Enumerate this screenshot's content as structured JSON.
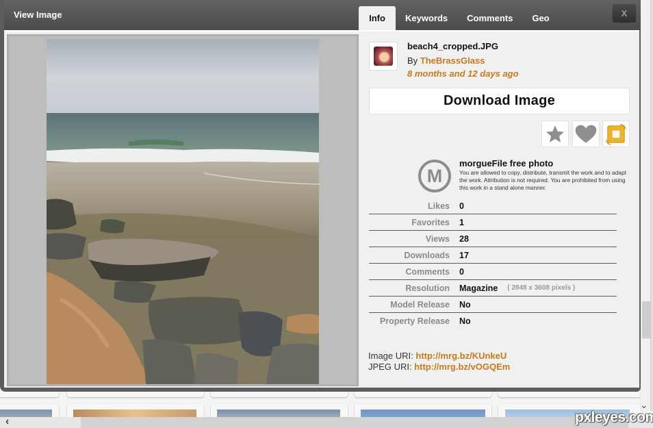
{
  "modal": {
    "title": "View Image",
    "close_label": "X",
    "tabs": [
      {
        "label": "Info",
        "active": true
      },
      {
        "label": "Keywords",
        "active": false
      },
      {
        "label": "Comments",
        "active": false
      },
      {
        "label": "Geo",
        "active": false
      }
    ]
  },
  "photo": {
    "description": "Beach scene with grey overcast sky, green-grey sea with breaking waves, wet sand and rocks in the foreground"
  },
  "info": {
    "filename": "beach4_cropped.JPG",
    "by_prefix": "By",
    "author": "TheBrassGlass",
    "posted": "8 months and 12 days ago",
    "download_label": "Download Image",
    "actions": [
      {
        "name": "favorite",
        "icon": "star-icon"
      },
      {
        "name": "like",
        "icon": "heart-icon"
      },
      {
        "name": "lightbox",
        "icon": "frame-icon"
      }
    ],
    "license": {
      "logo_letter": "M",
      "title": "morgueFile free photo",
      "text": "You are allowed to copy, distribute, transmit the work and to adapt the work. Attribution is not required. You are prohibited from using this work in a stand alone manner."
    },
    "meta": [
      {
        "label": "Likes",
        "value": "0"
      },
      {
        "label": "Favorites",
        "value": "1"
      },
      {
        "label": "Views",
        "value": "28"
      },
      {
        "label": "Downloads",
        "value": "17"
      },
      {
        "label": "Comments",
        "value": "0"
      },
      {
        "label": "Resolution",
        "value": "Magazine",
        "extra": "( 2848 x 3608 pixels )"
      },
      {
        "label": "Model Release",
        "value": "No"
      },
      {
        "label": "Property Release",
        "value": "No"
      }
    ],
    "image_uri_label": "Image URI:",
    "image_uri": "http://mrg.bz/KUnkeU",
    "jpeg_uri_label": "JPEG URI:",
    "jpeg_uri": "http://mrg.bz/vOGQEm"
  },
  "background": {
    "watermark": "pxleyes.com",
    "scroll_left_glyph": "‹",
    "scroll_down_glyph": "⌄"
  },
  "colors": {
    "accent": "#c47a1e",
    "header": "#555555",
    "panel": "#f0f0f0"
  }
}
